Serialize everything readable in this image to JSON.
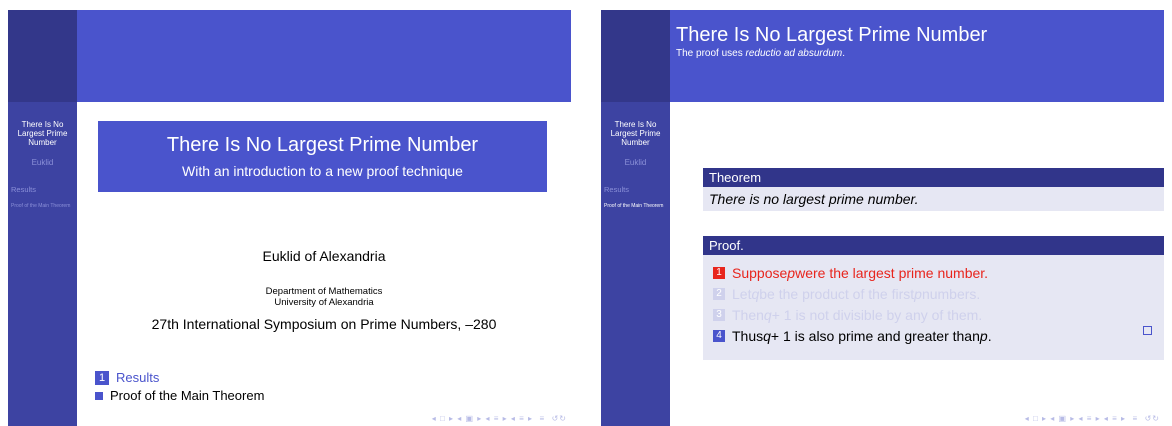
{
  "sidebar": {
    "title": "There Is No Largest Prime Number",
    "author": "Euklid",
    "section": "Results",
    "subsection": "Proof of the Main Theorem"
  },
  "title_slide": {
    "title": "There Is No Largest Prime Number",
    "subtitle": "With an introduction to a new proof technique",
    "author": "Euklid of Alexandria",
    "institute_line1": "Department of Mathematics",
    "institute_line2": "University of Alexandria",
    "conference": "27th International Symposium on Prime Numbers, –280",
    "toc": {
      "section_number": "1",
      "section": "Results",
      "subsection": "Proof of the Main Theorem"
    }
  },
  "proof_slide": {
    "frame_title": "There Is No Largest Prime Number",
    "frame_subtitle_prefix": "The proof uses ",
    "frame_subtitle_emph": "reductio ad absurdum",
    "frame_subtitle_suffix": ".",
    "theorem_title": "Theorem",
    "theorem_text": "There is no largest prime number.",
    "proof_title": "Proof.",
    "steps": [
      {
        "number": "1",
        "pre": "Suppose ",
        "var": "p",
        "post": " were the largest prime number.",
        "state": "alert"
      },
      {
        "number": "2",
        "pre": "Let ",
        "var": "q",
        "post": " be the product of the first ",
        "var2": "p",
        "post2": " numbers.",
        "state": "covered"
      },
      {
        "number": "3",
        "pre": "Then ",
        "var": "q",
        "post": " + 1 is not divisible by any of them.",
        "state": "covered"
      },
      {
        "number": "4",
        "pre": "Thus ",
        "var": "q",
        "post": " + 1 is also prime and greater than ",
        "var2": "p",
        "post2": ".",
        "state": "normal"
      }
    ]
  },
  "colors": {
    "sidebar": "#3d43a2",
    "header": "#4a54cc",
    "block_head": "#31358a",
    "block_body": "#e6e7f3",
    "alert": "#e8251d",
    "covered": "#cfd1ec"
  },
  "icons": {
    "nav": "beamer-navigation-symbols",
    "qed": "qed-square-icon"
  }
}
